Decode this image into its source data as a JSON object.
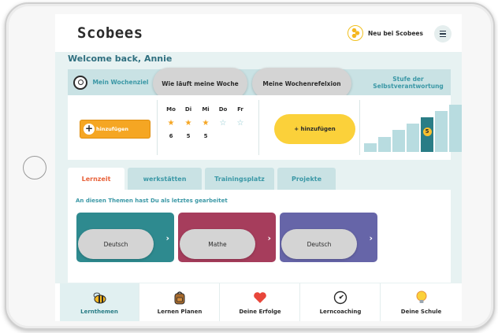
{
  "header": {
    "logo": "Scobees",
    "new_label": "Neu bei Scobees"
  },
  "welcome": "Welcome back, Annie",
  "goals": {
    "weekly_goal_label": "Mein Wochenziel",
    "week_question": "Wie läuft meine Woche",
    "reflection_label": "Meine Wochenrefelxion",
    "level_title": "Stufe der Selbstverantwortung",
    "add_goal_label": "hinzufügen",
    "add_reflection_label": "+ hinzufügen",
    "days": [
      {
        "name": "Mo",
        "starred": true,
        "count": "6"
      },
      {
        "name": "Di",
        "starred": true,
        "count": "5"
      },
      {
        "name": "Mi",
        "starred": true,
        "count": "5"
      },
      {
        "name": "Do",
        "starred": false,
        "count": ""
      },
      {
        "name": "Fr",
        "starred": false,
        "count": ""
      }
    ],
    "level": {
      "current": "5",
      "max": 7,
      "bar_fractions": [
        0.18,
        0.32,
        0.46,
        0.6,
        0.74,
        0.86,
        1.0
      ]
    }
  },
  "tabs": [
    {
      "label": "Lernzeit",
      "active": true
    },
    {
      "label": "werkstätten",
      "active": false
    },
    {
      "label": "Trainingsplatz",
      "active": false
    },
    {
      "label": "Projekte",
      "active": false
    }
  ],
  "recent": {
    "title": "An diesen Themen hast Du als letztes gearbeitet",
    "cards": [
      {
        "label": "Deutsch",
        "color": "#2e8a8f"
      },
      {
        "label": "Mathe",
        "color": "#a63d5c"
      },
      {
        "label": "Deutsch",
        "color": "#6665a8"
      }
    ]
  },
  "nav": [
    {
      "label": "Lernthemen",
      "icon": "bee-icon",
      "active": true
    },
    {
      "label": "Lernen Planen",
      "icon": "backpack-icon",
      "active": false
    },
    {
      "label": "Deine Erfolge",
      "icon": "heart-icon",
      "active": false
    },
    {
      "label": "Lerncoaching",
      "icon": "gauge-icon",
      "active": false
    },
    {
      "label": "Deine Schule",
      "icon": "bulb-icon",
      "active": false
    }
  ],
  "colors": {
    "teal": "#2a7d86",
    "orange": "#f5a623",
    "yellow": "#fbd13a",
    "active_tab": "#e8623a"
  }
}
